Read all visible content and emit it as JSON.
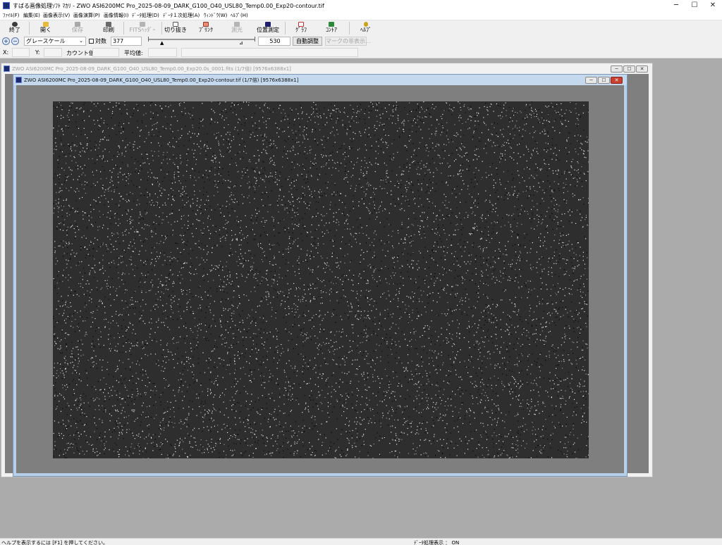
{
  "app": {
    "title": "すばる画像処理ｿﾌﾄ ﾏｶﾘ - ZWO ASI6200MC Pro_2025-08-09_DARK_G100_O40_USL80_Temp0.00_Exp20-contour.tif",
    "minimize": "─",
    "maximize": "☐",
    "close": "✕"
  },
  "menu": [
    "ﾌｧｲﾙ(F)",
    "編集(E)",
    "画像表示(V)",
    "画像演算(P)",
    "画像情報(I)",
    "ﾃﾞｰﾀ処理(D)",
    "ﾃﾞｰﾀ１次処理(A)",
    "ｳｨﾝﾄﾞｳ(W)",
    "ﾍﾙﾌﾟ(H)"
  ],
  "toolbar": [
    {
      "label": "終了",
      "icon": "power-icon",
      "enabled": true
    },
    {
      "label": "開く",
      "icon": "folder-icon",
      "enabled": true
    },
    {
      "label": "保存",
      "icon": "save-icon",
      "enabled": false
    },
    {
      "label": "印刷",
      "icon": "printer-icon",
      "enabled": true
    },
    {
      "label": "FITSﾍｯﾀﾞｰ",
      "icon": "fits-header-icon",
      "enabled": false
    },
    {
      "label": "切り抜き",
      "icon": "crop-icon",
      "enabled": true
    },
    {
      "label": "ﾌﾞﾘﾝｸ",
      "icon": "blink-icon",
      "enabled": true
    },
    {
      "label": "測光",
      "icon": "photometry-icon",
      "enabled": false
    },
    {
      "label": "位置測定",
      "icon": "position-icon",
      "enabled": true
    },
    {
      "label": "ｸﾞﾗﾌ",
      "icon": "graph-icon",
      "enabled": true
    },
    {
      "label": "ｺﾝﾄｱ",
      "icon": "contour-icon",
      "enabled": true
    },
    {
      "label": "ﾍﾙﾌﾟ",
      "icon": "help-icon",
      "enabled": true
    }
  ],
  "display": {
    "zoom_in": "+",
    "zoom_out": "−",
    "color_mode": "グレースケール",
    "log_label": "対数",
    "log_checked": false,
    "min_value": "377",
    "max_value": "530",
    "auto_adjust": "自動調整",
    "hide_marks": "マークの非表示..."
  },
  "info": {
    "x_label": "X:",
    "y_label": "Y:",
    "count_label": "カウント値:",
    "average_label": "平均値:",
    "x": "",
    "y": "",
    "count": "",
    "average": ""
  },
  "windows": [
    {
      "title": "ZWO ASI6200MC Pro_2025-08-09_DARK_G100_O40_USL80_Temp0.00_Exp20.0s_0001.fits (1/7倍) [9576x6388x1]",
      "active": false
    },
    {
      "title": "ZWO ASI6200MC Pro_2025-08-09_DARK_G100_O40_USL80_Temp0.00_Exp20-contour.tif (1/7倍) [9576x6388x1]",
      "active": true
    }
  ],
  "status": {
    "help_hint": "ヘルプを表示するには [F1] を押してください。",
    "data_processing": "ﾃﾞｰﾀ処理表示 ： ON"
  }
}
